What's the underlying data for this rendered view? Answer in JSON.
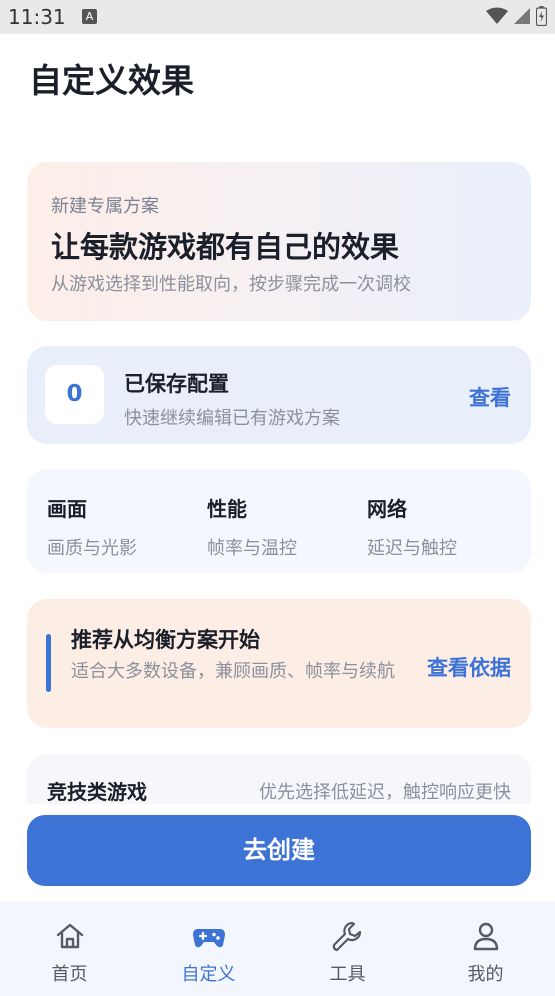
{
  "status": {
    "time": "11:31",
    "a_badge": "A"
  },
  "page": {
    "title": "自定义效果"
  },
  "hero": {
    "subtitle": "新建专属方案",
    "title": "让每款游戏都有自己的效果",
    "description": "从游戏选择到性能取向，按步骤完成一次调校"
  },
  "saved": {
    "count": "0",
    "title": "已保存配置",
    "description": "快速继续编辑已有游戏方案",
    "link": "查看"
  },
  "categories": [
    {
      "title": "画面",
      "description": "画质与光影"
    },
    {
      "title": "性能",
      "description": "帧率与温控"
    },
    {
      "title": "网络",
      "description": "延迟与触控"
    }
  ],
  "recommend": {
    "title": "推荐从均衡方案开始",
    "description": "适合大多数设备，兼顾画质、帧率与续航",
    "link": "查看依据"
  },
  "compete": {
    "title": "竞技类游戏",
    "description": "优先选择低延迟，触控响应更快"
  },
  "create_button": "去创建",
  "tabs": [
    {
      "label": "首页",
      "icon": "home-icon"
    },
    {
      "label": "自定义",
      "icon": "gamepad-icon"
    },
    {
      "label": "工具",
      "icon": "wrench-icon"
    },
    {
      "label": "我的",
      "icon": "person-icon"
    }
  ],
  "colors": {
    "accent": "#3e73d6",
    "text": "#1b1f2a",
    "muted": "#8b909b"
  }
}
